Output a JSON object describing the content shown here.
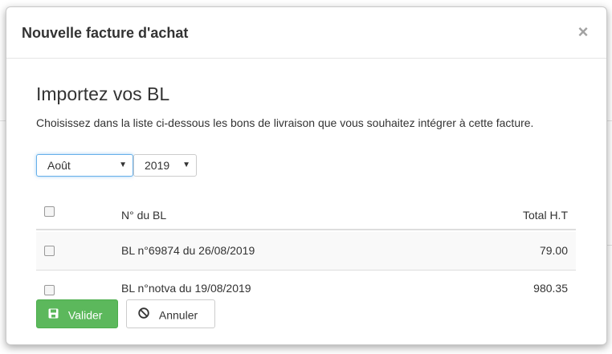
{
  "modal": {
    "title": "Nouvelle facture d'achat",
    "close_symbol": "×"
  },
  "section": {
    "title": "Importez vos BL",
    "instructions": "Choisissez dans la liste ci-dessous les bons de livraison que vous souhaitez intégrer à cette facture."
  },
  "filters": {
    "month": "Août",
    "year": "2019"
  },
  "table": {
    "headers": {
      "number": "N° du BL",
      "total": "Total H.T"
    },
    "rows": [
      {
        "number": "BL n°69874 du 26/08/2019",
        "total": "79.00"
      },
      {
        "number": "BL n°notva du 19/08/2019",
        "total": "980.35"
      }
    ]
  },
  "buttons": {
    "save_label": "Valider",
    "save_icon": "floppy-disk-icon",
    "cancel_label": "Annuler",
    "cancel_icon": "ban-circle-icon"
  },
  "colors": {
    "save": "#5cb85c",
    "focus": "#66afe9"
  }
}
